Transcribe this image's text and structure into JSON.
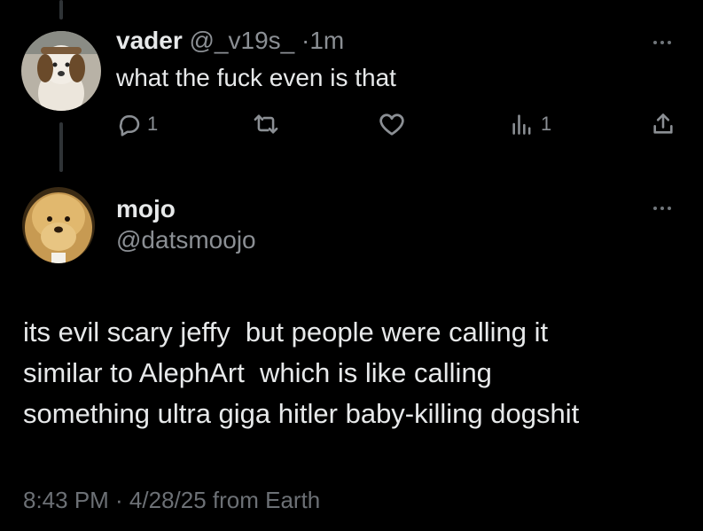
{
  "reply": {
    "display_name": "vader",
    "handle": "@_v19s_",
    "separator": "·",
    "time": "1m",
    "text": "what the fuck even is that",
    "actions": {
      "reply_count": "1",
      "views_count": "1"
    }
  },
  "tweet": {
    "display_name": "mojo",
    "handle": "@datsmoojo",
    "lines": [
      "its evil scary jeffy  but people were calling it",
      "similar to AlephArt  which is like calling",
      "something ultra giga hitler baby-killing dogshit"
    ],
    "timestamp": "8:43 PM · 4/28/25 from Earth"
  },
  "icons": {
    "reply": "reply-icon",
    "repost": "repost-icon",
    "like": "heart-icon",
    "views": "views-icon",
    "share": "share-icon",
    "more": "more-icon"
  },
  "colors": {
    "background": "#000000",
    "text": "#e7e9ea",
    "muted": "#8b8f94"
  }
}
